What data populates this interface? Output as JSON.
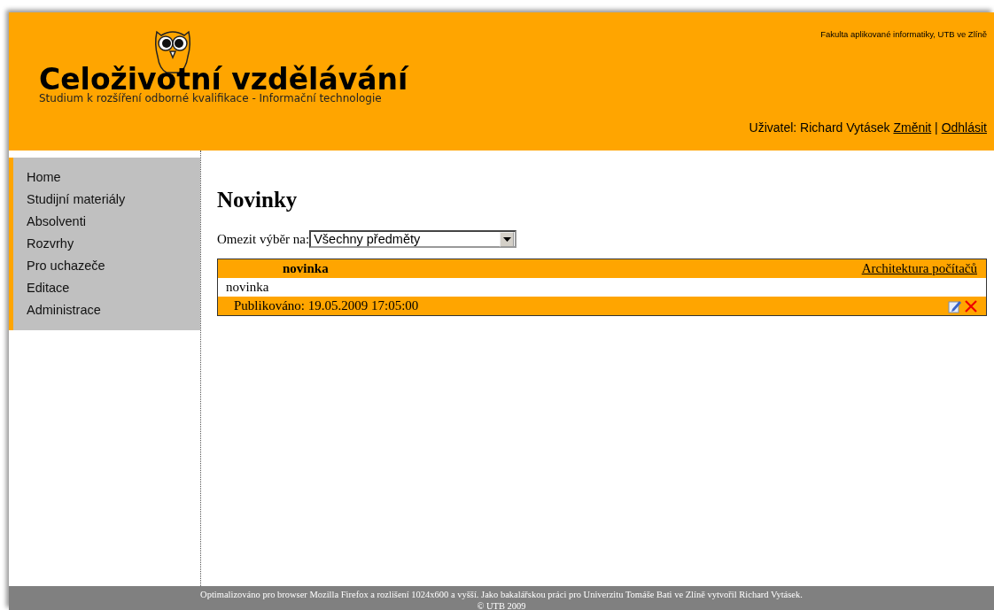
{
  "header": {
    "title": "Celoživotní vzdělávání",
    "subtitle": "Studium k rozšíření odborné kvalifikace - Informační technologie",
    "faculty": "Fakulta aplikované informatiky, UTB ve Zlíně",
    "user_label": "Uživatel: Richard Vytásek",
    "change_link": "Změnit",
    "separator": "|",
    "logout_link": "Odhlásit"
  },
  "sidebar": {
    "items": [
      {
        "label": "Home"
      },
      {
        "label": "Studijní materiály"
      },
      {
        "label": "Absolventi"
      },
      {
        "label": "Rozvrhy"
      },
      {
        "label": "Pro uchazeče"
      },
      {
        "label": "Editace"
      },
      {
        "label": "Administrace"
      }
    ]
  },
  "content": {
    "heading": "Novinky",
    "filter_label": "Omezit výběr na:",
    "filter_value": "Všechny předměty",
    "news": [
      {
        "title": "novinka",
        "subject": "Architektura počítačů",
        "body": "novinka",
        "published": "Publikováno: 19.05.2009 17:05:00"
      }
    ]
  },
  "footer": {
    "lines": [
      "Optimalizováno pro browser Mozilla Firefox a rozlišení 1024x600 a vyšší. Jako bakalářskou práci pro Univerzitu Tomáše Bati ve Zlíně vytvořil Richard Vytásek.",
      "© UTB 2009"
    ]
  }
}
